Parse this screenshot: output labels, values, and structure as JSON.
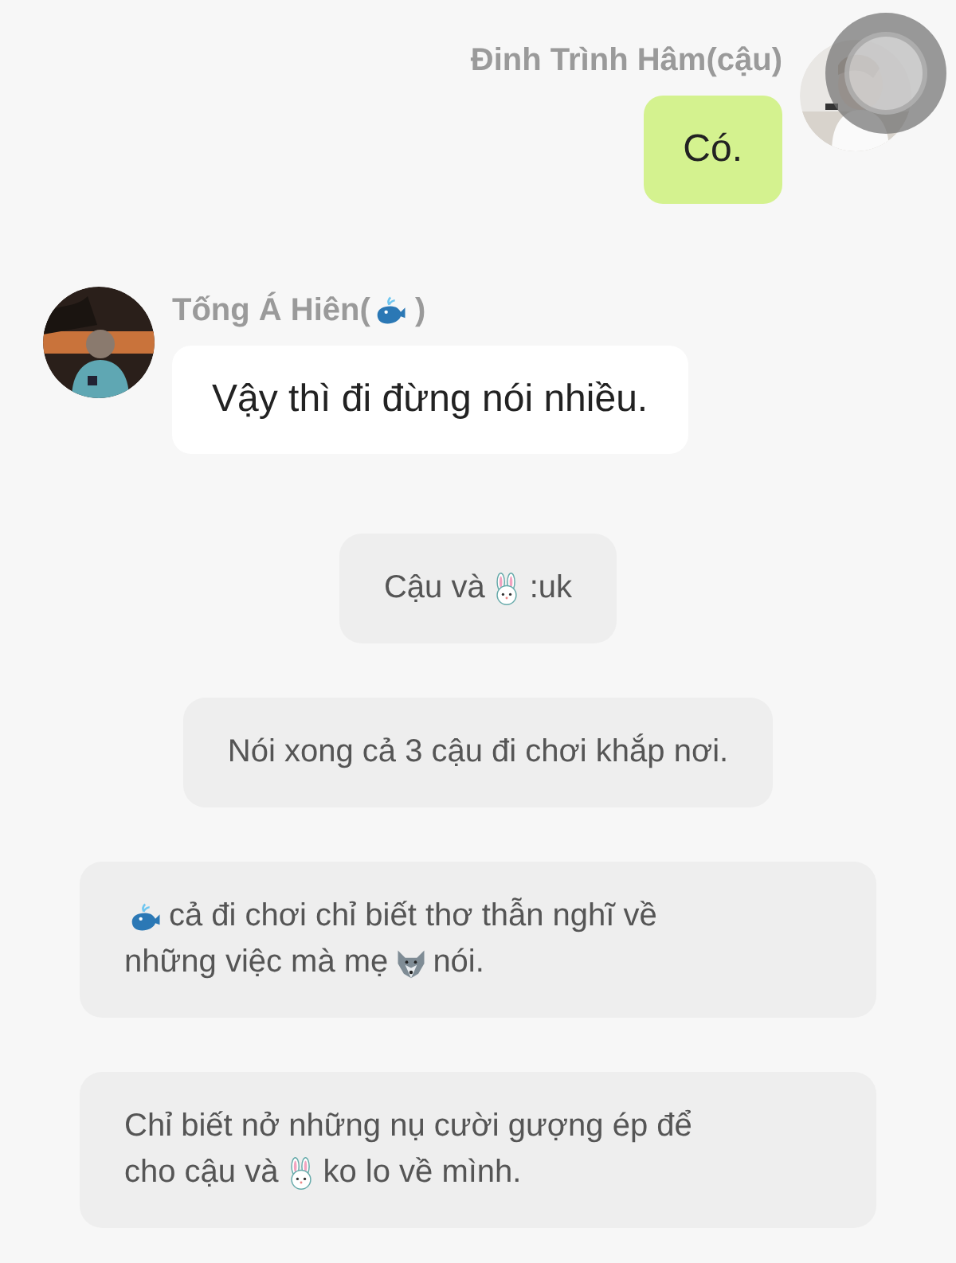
{
  "messages": [
    {
      "kind": "outgoing",
      "sender": [
        {
          "kind": "text",
          "text": "Đinh Trình Hâm(cậu)"
        }
      ],
      "lines": [
        [
          {
            "kind": "text",
            "text": "Có."
          }
        ]
      ]
    },
    {
      "kind": "incoming",
      "sender": [
        {
          "kind": "text",
          "text": "Tống Á Hiên("
        },
        {
          "kind": "whale"
        },
        {
          "kind": "text",
          "text": ")"
        }
      ],
      "lines": [
        [
          {
            "kind": "text",
            "text": "Vậy thì đi đừng nói nhiều."
          }
        ]
      ]
    },
    {
      "kind": "narration",
      "lines": [
        [
          {
            "kind": "text",
            "text": "Cậu và"
          },
          {
            "kind": "rabbit"
          },
          {
            "kind": "text",
            "text": ":uk"
          }
        ]
      ]
    },
    {
      "kind": "narration",
      "lines": [
        [
          {
            "kind": "text",
            "text": "Nói xong cả 3 cậu đi chơi khắp nơi."
          }
        ]
      ]
    },
    {
      "kind": "narration",
      "lines": [
        [
          {
            "kind": "whale"
          },
          {
            "kind": "text",
            "text": "cả đi chơi chỉ biết thơ thẫn nghĩ về"
          }
        ],
        [
          {
            "kind": "text",
            "text": "những việc mà mẹ"
          },
          {
            "kind": "wolf"
          },
          {
            "kind": "text",
            "text": "nói."
          }
        ]
      ]
    },
    {
      "kind": "narration",
      "lines": [
        [
          {
            "kind": "text",
            "text": "Chỉ biết nở những nụ cười gượng ép để"
          }
        ],
        [
          {
            "kind": "text",
            "text": "cho cậu và"
          },
          {
            "kind": "rabbit"
          },
          {
            "kind": "text",
            "text": "ko lo về mình."
          }
        ]
      ]
    }
  ]
}
